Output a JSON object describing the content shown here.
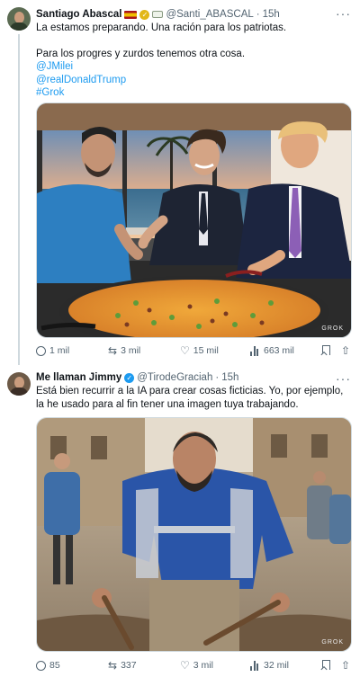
{
  "tweet1": {
    "name": "Santiago Abascal",
    "handle": "@Santi_ABASCAL",
    "time": "15h",
    "text_line1": "La estamos preparando. Una ración para los patriotas.",
    "text_line2": "Para los progres y zurdos tenemos otra cosa.",
    "mention1": "@JMilei",
    "mention2": "@realDonaldTrump",
    "hashtag": "#Grok",
    "watermark": "GROK",
    "replies": "1 mil",
    "retweets": "3 mil",
    "likes": "15 mil",
    "views": "663 mil"
  },
  "tweet2": {
    "name": "Me llaman Jimmy",
    "handle": "@TirodeGraciah",
    "time": "15h",
    "text": "Está bien recurrir a la IA para crear cosas ficticias. Yo, por ejemplo, la he usado para al fin tener una imagen tuya trabajando.",
    "watermark": "GROK",
    "replies": "85",
    "retweets": "337",
    "likes": "3 mil",
    "views": "32 mil"
  },
  "icons": {
    "reply": "reply-icon",
    "retweet": "retweet-icon",
    "like": "heart-icon",
    "views": "views-icon",
    "bookmark": "bookmark-icon",
    "share": "share-icon",
    "more": "more-icon"
  },
  "colors": {
    "link": "#1d9bf0",
    "secondary_text": "#536471",
    "verified_gold": "#e2b719",
    "verified_blue": "#1d9bf0"
  }
}
